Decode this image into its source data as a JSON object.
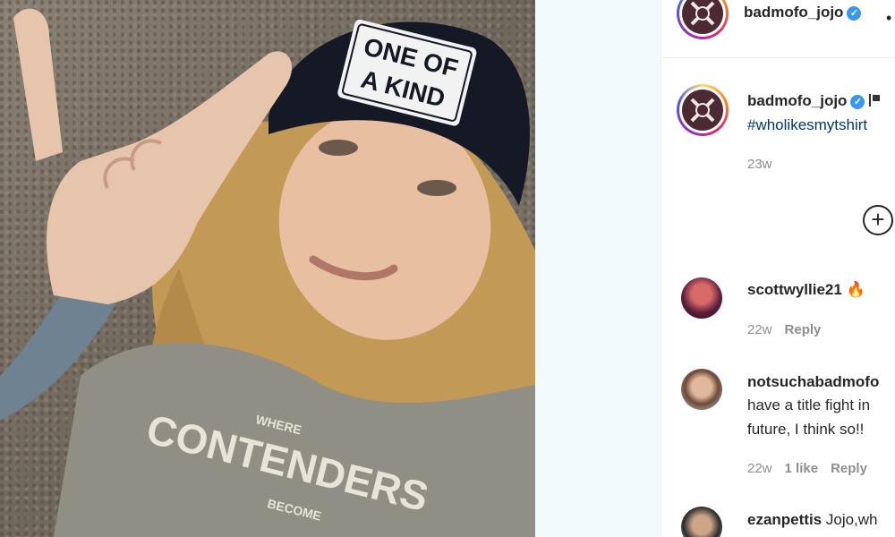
{
  "post": {
    "username": "badmofo_jojo",
    "verified_mark": "✓",
    "caption_hashtag": "#wholikesmytshirt",
    "age": "23w",
    "photo": {
      "beanie_text": [
        "ONE OF",
        "A KIND"
      ],
      "shirt_text": [
        "CONTENDERS",
        "WHERE",
        "BECOME"
      ]
    }
  },
  "comments": [
    {
      "username": "scottwyllie21",
      "text": "",
      "emoji": "🔥",
      "age": "22w",
      "likes": "",
      "reply_label": "Reply"
    },
    {
      "username": "notsuchabadmofo",
      "lines": [
        "have a title fight in",
        "future, I think so!!"
      ],
      "age": "22w",
      "likes": "1 like",
      "reply_label": "Reply"
    },
    {
      "username": "ezanpettis",
      "text": "Jojo,wh"
    }
  ],
  "icons": {
    "add": "plus-circle-icon",
    "verified": "verified-badge-icon",
    "flag": "flag-icon"
  },
  "colors": {
    "link": "#00376b",
    "muted": "#8e8e8e",
    "verified": "#3897f0"
  }
}
